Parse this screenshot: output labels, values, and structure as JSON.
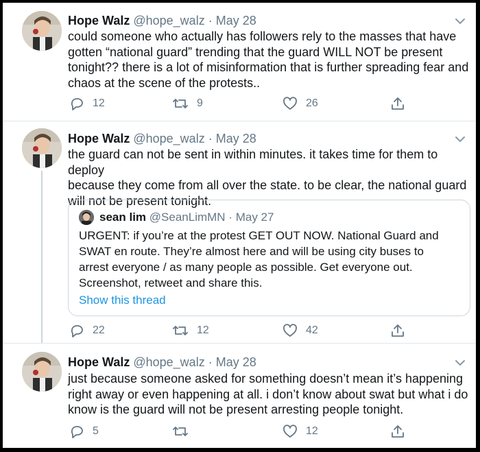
{
  "tweets": [
    {
      "name": "Hope Walz",
      "handle": "@hope_walz",
      "separator": "·",
      "date": "May 28",
      "text": "could someone who actually has followers rely to the masses that have\ngotten “national guard” trending that the guard WILL NOT be present\ntonight?? there is a lot of misinformation that is further spreading fear and\nchaos at the scene of the protests..",
      "replies": "12",
      "retweets": "9",
      "likes": "26"
    },
    {
      "name": "Hope Walz",
      "handle": "@hope_walz",
      "separator": "·",
      "date": "May 28",
      "text": "the guard can not be sent in within minutes. it takes time for them to deploy\nbecause they come from all over the state. to be clear, the national guard\nwill not be present tonight.",
      "quote": {
        "name": "sean lim",
        "handle": "@SeanLimMN",
        "separator": "·",
        "date": "May 27",
        "text": "URGENT: if you’re at the protest GET OUT NOW. National Guard and\nSWAT en route. They’re almost here and will be using city buses to\narrest everyone / as many people as possible. Get everyone out.\nScreenshot, retweet and share this.",
        "link": "Show this thread"
      },
      "replies": "22",
      "retweets": "12",
      "likes": "42"
    },
    {
      "name": "Hope Walz",
      "handle": "@hope_walz",
      "separator": "·",
      "date": "May 28",
      "text": "just because someone asked for something doesn’t mean it’s happening\nright away or even happening at all. i don’t know about swat but what i do\nknow is the guard will not be present arresting people tonight.",
      "replies": "5",
      "retweets": "",
      "likes": "12"
    }
  ],
  "icons": {
    "reply": "reply-icon",
    "retweet": "retweet-icon",
    "like": "like-icon",
    "share": "share-icon",
    "more": "chevron-down-icon"
  },
  "colors": {
    "link": "#1b95e0",
    "secondary_text": "#657786",
    "border": "#e1e8ed"
  }
}
